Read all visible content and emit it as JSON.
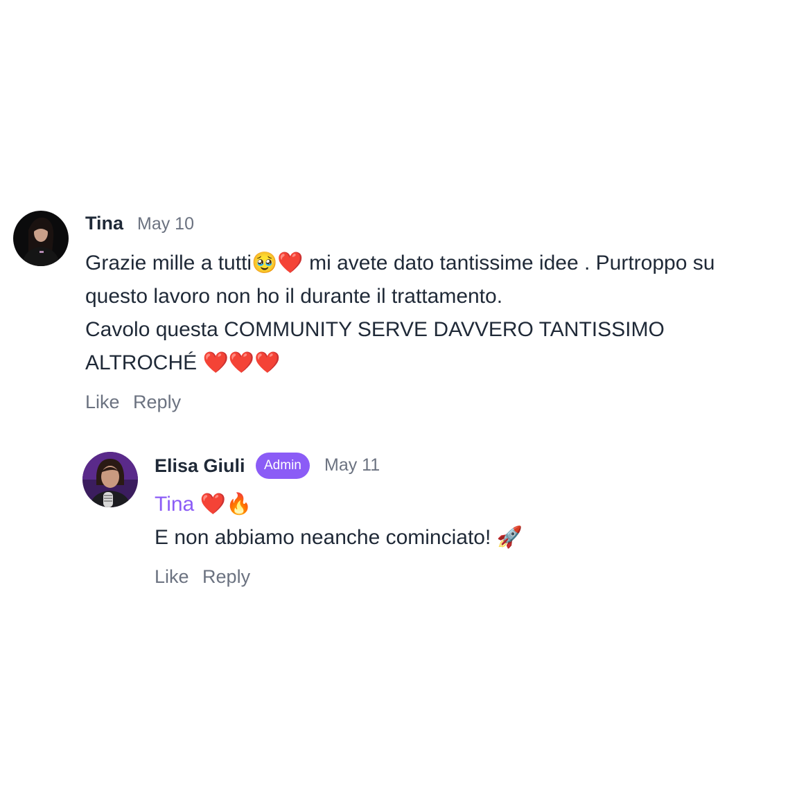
{
  "comments": [
    {
      "author": "Tina",
      "date": "May 10",
      "lines": [
        "Grazie mille a tutti🥹❤️ mi avete dato tantissime idee . Purtroppo su",
        "questo lavoro non ho il durante il trattamento.",
        "Cavolo questa COMMUNITY SERVE DAVVERO TANTISSIMO",
        "ALTROCHÉ ❤️❤️❤️"
      ],
      "like_label": "Like",
      "reply_label": "Reply"
    }
  ],
  "reply": {
    "author": "Elisa Giuli",
    "badge": "Admin",
    "date": "May 11",
    "mention": "Tina",
    "mention_suffix": " ❤️🔥",
    "line2": "E non abbiamo neanche cominciato! 🚀",
    "like_label": "Like",
    "reply_label": "Reply"
  },
  "colors": {
    "accent": "#8b5cf6",
    "text": "#1f2937",
    "muted": "#6b7280"
  }
}
